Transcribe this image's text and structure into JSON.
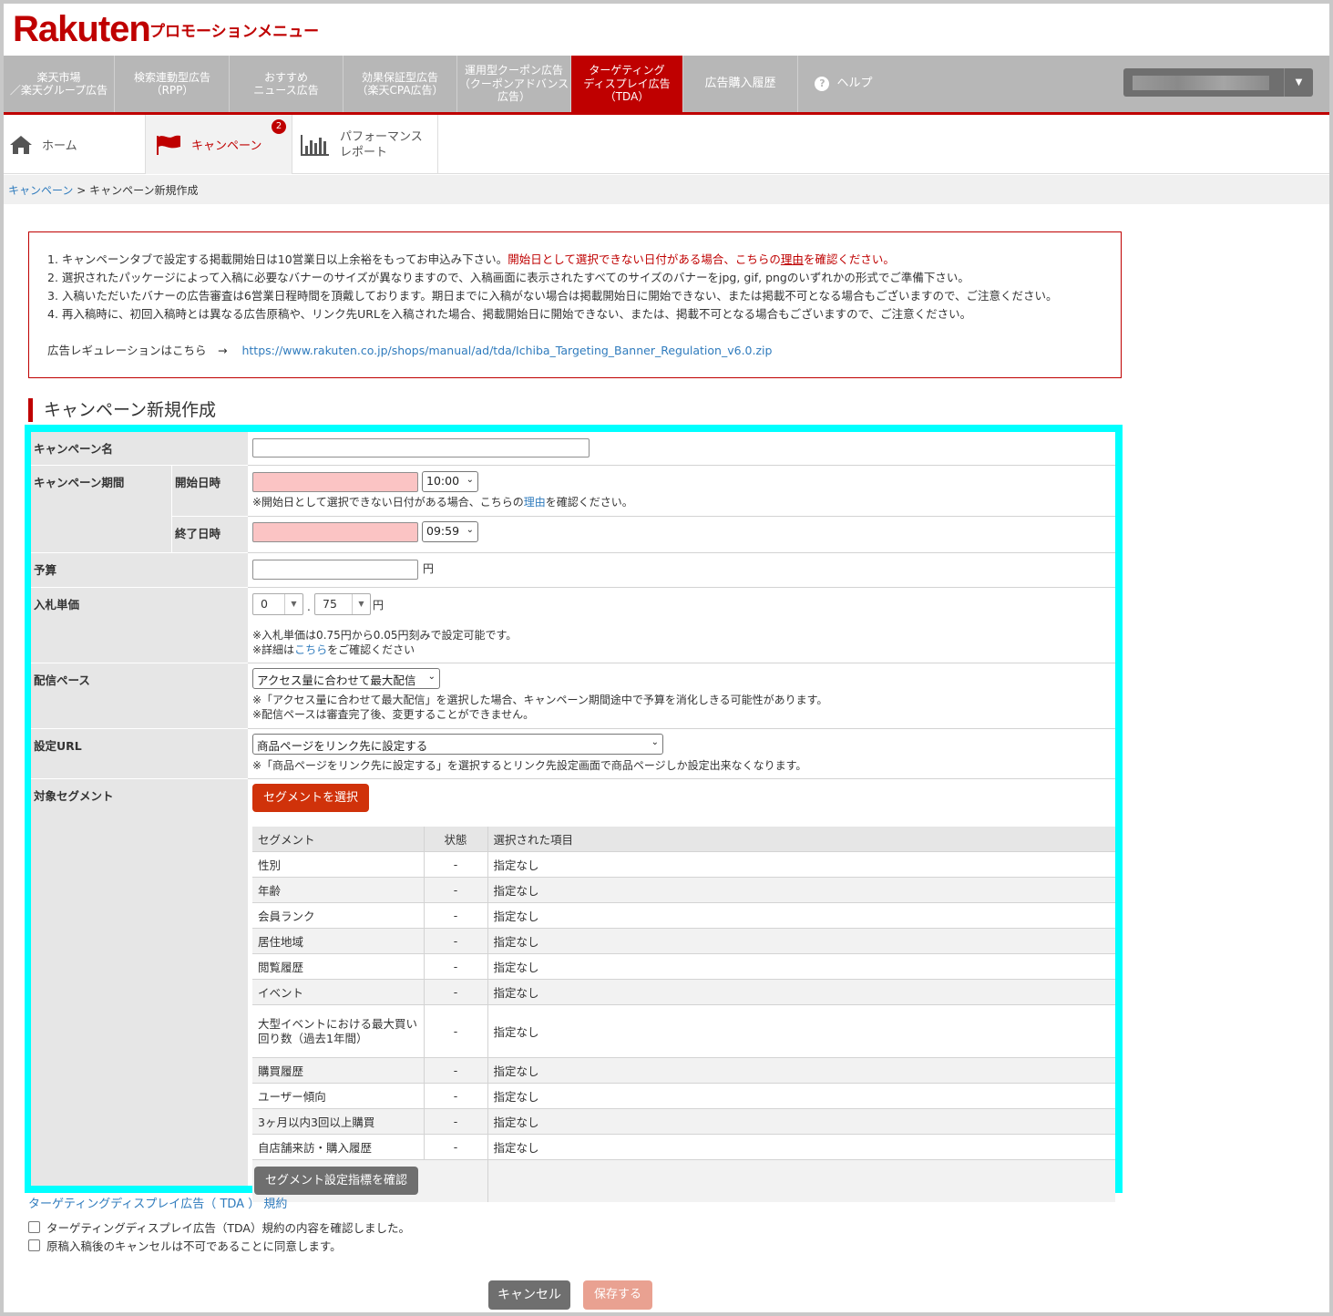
{
  "header": {
    "logo": "Rakuten",
    "title": "プロモーションメニュー"
  },
  "main_nav": {
    "items": [
      {
        "label": "楽天市場\n／楽天グループ広告"
      },
      {
        "label": "検索連動型広告\n（RPP）"
      },
      {
        "label": "おすすめ\nニュース広告"
      },
      {
        "label": "効果保証型広告\n（楽天CPA広告）"
      },
      {
        "label": "運用型クーポン広告\n（クーポンアドバンス\n広告）"
      },
      {
        "label": "ターゲティング\nディスプレイ広告\n（TDA）"
      },
      {
        "label": "広告購入履歴"
      },
      {
        "label": "ヘルプ"
      }
    ],
    "help_icon": "?",
    "account_caret": "▼"
  },
  "sub_nav": {
    "home": "ホーム",
    "campaign": "キャンペーン",
    "campaign_badge": "2",
    "report": "パフォーマンス\nレポート"
  },
  "breadcrumb": {
    "link": "キャンペーン",
    "sep": " > ",
    "current": "キャンペーン新規作成"
  },
  "notice": {
    "line1_a": "1. キャンペーンタブで設定する掲載開始日は10営業日以上余裕をもってお申込み下さい。",
    "line1_b": "開始日として選択できない日付がある場合、こちらの",
    "line1_link": "理由",
    "line1_c": "を確認ください。",
    "line2": "2. 選択されたパッケージによって入稿に必要なバナーのサイズが異なりますので、入稿画面に表示されたすべてのサイズのバナーをjpg, gif, pngのいずれかの形式でご準備下さい。",
    "line3": "3. 入稿いただいたバナーの広告審査は6営業日程時間を頂戴しております。期日までに入稿がない場合は掲載開始日に開始できない、または掲載不可となる場合もございますので、ご注意ください。",
    "line4": "4. 再入稿時に、初回入稿時とは異なる広告原稿や、リンク先URLを入稿された場合、掲載開始日に開始できない、または、掲載不可となる場合もございますので、ご注意ください。",
    "regulation_label": "広告レギュレーションはこちら　→",
    "regulation_url": "https://www.rakuten.co.jp/shops/manual/ad/tda/Ichiba_Targeting_Banner_Regulation_v6.0.zip"
  },
  "section_title": "キャンペーン新規作成",
  "form": {
    "campaign_name_label": "キャンペーン名",
    "campaign_name_value": "",
    "period_label": "キャンペーン期間",
    "start_label": "開始日時",
    "start_date": "",
    "start_time": "10:00",
    "start_note_a": "※開始日として選択できない日付がある場合、こちらの",
    "start_note_link": "理由",
    "start_note_b": "を確認ください。",
    "end_label": "終了日時",
    "end_date": "",
    "end_time": "09:59",
    "budget_label": "予算",
    "budget_value": "",
    "yen": "円",
    "bid_label": "入札単価",
    "bid_int": "0",
    "bid_dot": ".",
    "bid_dec": "75",
    "bid_note1": "※入札単価は0.75円から0.05円刻みで設定可能です。",
    "bid_note2_a": "※詳細は",
    "bid_note2_link": "こちら",
    "bid_note2_b": "をご確認ください",
    "pace_label": "配信ペース",
    "pace_value": "アクセス量に合わせて最大配信",
    "pace_note": "※「アクセス量に合わせて最大配信」を選択した場合、キャンペーン期間途中で予算を消化しきる可能性があります。\n※配信ペースは審査完了後、変更することができません。",
    "url_label": "設定URL",
    "url_value": "商品ページをリンク先に設定する",
    "url_note": "※「商品ページをリンク先に設定する」を選択するとリンク先設定画面で商品ページしか設定出来なくなります。",
    "segment_label": "対象セグメント",
    "segment_button": "セグメントを選択",
    "segment_headers": [
      "セグメント",
      "状態",
      "選択された項目"
    ],
    "segments": [
      {
        "name": "性別",
        "status": "-",
        "selected": "指定なし"
      },
      {
        "name": "年齢",
        "status": "-",
        "selected": "指定なし"
      },
      {
        "name": "会員ランク",
        "status": "-",
        "selected": "指定なし"
      },
      {
        "name": "居住地域",
        "status": "-",
        "selected": "指定なし"
      },
      {
        "name": "閲覧履歴",
        "status": "-",
        "selected": "指定なし"
      },
      {
        "name": "イベント",
        "status": "-",
        "selected": "指定なし"
      },
      {
        "name": "大型イベントにおける最大買い回り数（過去1年間）",
        "status": "-",
        "selected": "指定なし"
      },
      {
        "name": "購買履歴",
        "status": "-",
        "selected": "指定なし"
      },
      {
        "name": "ユーザー傾向",
        "status": "-",
        "selected": "指定なし"
      },
      {
        "name": "3ヶ月以内3回以上購買",
        "status": "-",
        "selected": "指定なし"
      },
      {
        "name": "自店舗来訪・購入履歴",
        "status": "-",
        "selected": "指定なし"
      }
    ],
    "segment_check_button": "セグメント設定指標を確認"
  },
  "terms_link": "ターゲティングディスプレイ広告（ TDA ） 規約",
  "check1": "ターゲティングディスプレイ広告（TDA）規約の内容を確認しました。",
  "check2": "原稿入稿後のキャンセルは不可であることに同意します。",
  "cancel_button": "キャンセル",
  "save_button": "保存する",
  "colors": {
    "brand_red": "#bf0000",
    "highlight_cyan": "#00ffff",
    "nav_gray": "#b7b7b7"
  }
}
